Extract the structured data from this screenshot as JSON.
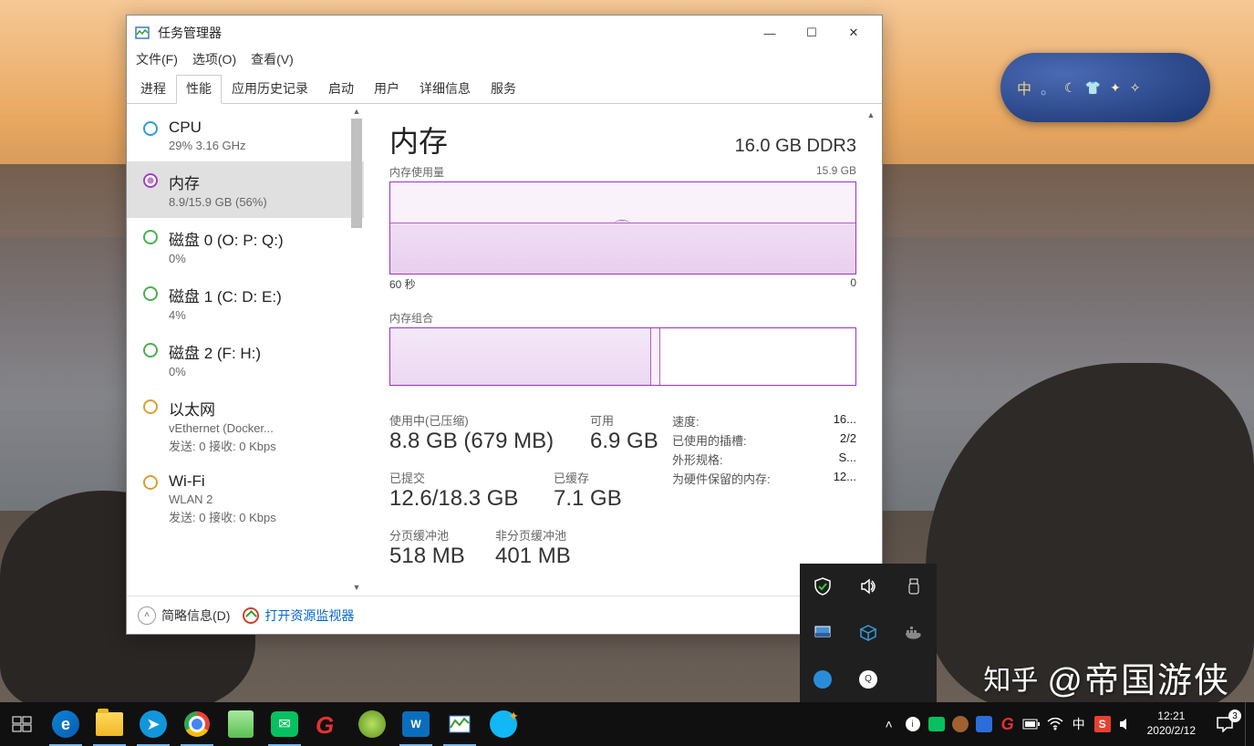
{
  "window": {
    "title": "任务管理器",
    "menu": {
      "file": "文件(F)",
      "options": "选项(O)",
      "view": "查看(V)"
    },
    "tabs": {
      "processes": "进程",
      "performance": "性能",
      "history": "应用历史记录",
      "startup": "启动",
      "users": "用户",
      "details": "详细信息",
      "services": "服务"
    },
    "window_controls": {
      "minimize": "—",
      "maximize": "☐",
      "close": "✕"
    },
    "footer": {
      "collapse": "简略信息(D)",
      "resmon": "打开资源监视器"
    }
  },
  "sidebar": {
    "items": [
      {
        "name": "CPU",
        "sub": "29%  3.16 GHz"
      },
      {
        "name": "内存",
        "sub": "8.9/15.9 GB (56%)"
      },
      {
        "name": "磁盘 0 (O: P: Q:)",
        "sub": "0%"
      },
      {
        "name": "磁盘 1 (C: D: E:)",
        "sub": "4%"
      },
      {
        "name": "磁盘 2 (F: H:)",
        "sub": "0%"
      },
      {
        "name": "以太网",
        "sub": "vEthernet (Docker...",
        "sub2": "发送: 0  接收: 0 Kbps"
      },
      {
        "name": "Wi-Fi",
        "sub": "WLAN 2",
        "sub2": "发送: 0  接收: 0 Kbps"
      }
    ]
  },
  "detail": {
    "title": "内存",
    "spec": "16.0 GB DDR3",
    "graph1_label": "内存使用量",
    "graph1_max": "15.9 GB",
    "axis_left": "60 秒",
    "axis_right": "0",
    "comp_label": "内存组合",
    "stats": {
      "in_use_label": "使用中(已压缩)",
      "in_use_value": "8.8 GB (679 MB)",
      "avail_label": "可用",
      "avail_value": "6.9 GB",
      "committed_label": "已提交",
      "committed_value": "12.6/18.3 GB",
      "cached_label": "已缓存",
      "cached_value": "7.1 GB",
      "paged_label": "分页缓冲池",
      "paged_value": "518 MB",
      "nonpaged_label": "非分页缓冲池",
      "nonpaged_value": "401 MB"
    },
    "right_stats": [
      {
        "k": "速度:",
        "v": "16..."
      },
      {
        "k": "已使用的插槽:",
        "v": "2/2"
      },
      {
        "k": "外形规格:",
        "v": "S..."
      },
      {
        "k": "为硬件保留的内存:",
        "v": "12..."
      }
    ]
  },
  "ime": {
    "lang": "中",
    "sep": "。",
    "moon": "☾",
    "shirt": "👕"
  },
  "tray_popup_icons": [
    "shield",
    "sound",
    "usb",
    "monitor",
    "cube",
    "docker",
    "todesk",
    "qq"
  ],
  "taskbar": {
    "tray": {
      "up": "^",
      "im1": "i",
      "wechat": "w",
      "head": "h",
      "blue": "b",
      "red": "r",
      "battery": "bat",
      "wifi": "wf",
      "ime": "中",
      "sogou": "S",
      "vol": "vol"
    },
    "clock": {
      "time": "12:21",
      "date": "2020/2/12"
    },
    "notif_count": "3"
  },
  "watermark": {
    "brand": "知乎",
    "at": "@帝国游侠"
  },
  "chart_data": {
    "type": "line",
    "title": "内存使用量",
    "ylabel": "内存 (GB)",
    "ylim": [
      0,
      15.9
    ],
    "x_range_seconds": [
      60,
      0
    ],
    "series": [
      {
        "name": "内存使用量",
        "approx_value_gb": 8.9,
        "percent": 56
      }
    ],
    "composition": {
      "in_use_gb": 8.8,
      "compressed_mb": 679,
      "cached_gb": 7.1,
      "available_gb": 6.9,
      "total_gb": 15.9
    }
  }
}
